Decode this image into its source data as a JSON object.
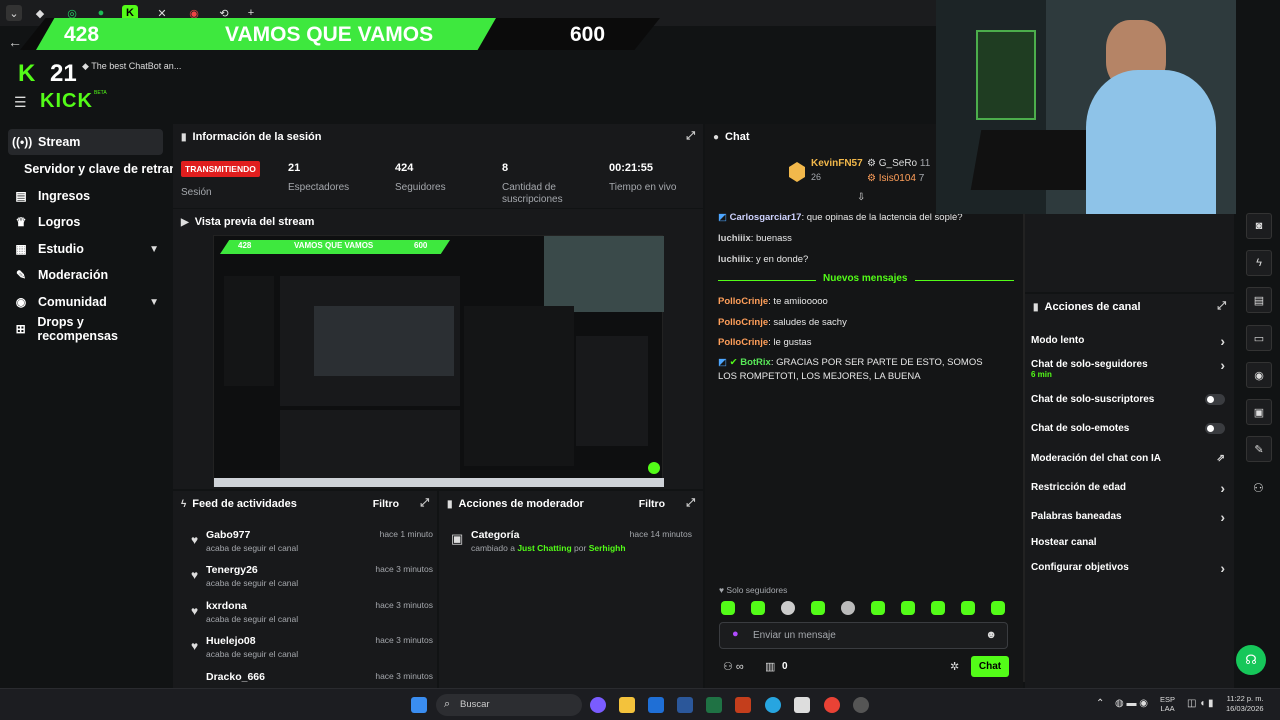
{
  "overlay": {
    "viewers": "428",
    "title": "VAMOS QUE VAMOS",
    "goal": "600",
    "kick_count": "21",
    "kick_logo": "KICK",
    "chatbot_text": "The best ChatBot an..."
  },
  "brand": {
    "logo": "KICK",
    "beta": "BETA",
    "accent": "#53fc18"
  },
  "sidebar": {
    "items": [
      {
        "label": "Stream",
        "icon": "stream-icon"
      },
      {
        "label": "Servidor y clave de retransm"
      },
      {
        "label": "Ingresos",
        "icon": "income-icon"
      },
      {
        "label": "Logros",
        "icon": "trophy-icon"
      },
      {
        "label": "Estudio",
        "icon": "studio-icon"
      },
      {
        "label": "Moderación",
        "icon": "wrench-icon"
      },
      {
        "label": "Comunidad",
        "icon": "community-icon"
      },
      {
        "label": "Drops y recompensas",
        "icon": "drops-icon"
      }
    ]
  },
  "session": {
    "title": "Información de la sesión",
    "status_badge": "TRANSMITIENDO",
    "status_label": "Sesión",
    "stats": [
      {
        "value": "21",
        "label": "Espectadores"
      },
      {
        "value": "424",
        "label": "Seguidores"
      },
      {
        "value": "8",
        "label": "Cantidad de suscripciones"
      },
      {
        "value": "00:21:55",
        "label": "Tiempo en vivo"
      }
    ]
  },
  "preview": {
    "title": "Vista previa del stream",
    "banner_viewers": "428",
    "banner_title": "VAMOS QUE VAMOS",
    "banner_goal": "600"
  },
  "activity": {
    "title": "Feed de actividades",
    "filter": "Filtro",
    "items": [
      {
        "name": "Gabo977",
        "action": "acaba de seguir el canal",
        "time": "hace 1 minuto"
      },
      {
        "name": "Tenergy26",
        "action": "acaba de seguir el canal",
        "time": "hace 3 minutos"
      },
      {
        "name": "kxrdona",
        "action": "acaba de seguir el canal",
        "time": "hace 3 minutos"
      },
      {
        "name": "Huelejo08",
        "action": "acaba de seguir el canal",
        "time": "hace 3 minutos"
      },
      {
        "name": "Dracko_666",
        "action": "",
        "time": "hace 3 minutos"
      }
    ]
  },
  "modactions": {
    "title": "Acciones de moderador",
    "filter": "Filtro",
    "item_title": "Categoría",
    "item_prefix": "cambiado a",
    "item_category": "Just Chatting",
    "item_by": "por",
    "item_user": "Serhighh",
    "item_time": "hace 14 minutos"
  },
  "chat": {
    "title": "Chat",
    "top": [
      {
        "name": "KevinFN57",
        "count": "26"
      },
      {
        "name": "G_SeRo",
        "count": "11"
      },
      {
        "name": "Isis0104",
        "count": "7"
      }
    ],
    "messages": [
      {
        "user": "Carlosgarciar17",
        "text": ": que opinas de la lactencia del soplé?"
      },
      {
        "user": "luchiiix",
        "text": ": buenass"
      },
      {
        "user": "luchiiix",
        "text": ": y en donde?"
      }
    ],
    "divider": "Nuevos mensajes",
    "new_messages": [
      {
        "user": "PolloCrinje",
        "text": ": te amiiooooo"
      },
      {
        "user": "PolloCrinje",
        "text": ": saludes de sachy"
      },
      {
        "user": "PolloCrinje",
        "text": ": le gustas"
      }
    ],
    "bot_user": "BotRix",
    "bot_text": ": GRACIAS POR SER PARTE DE ESTO, SOMOS LOS ROMPETOTI, LOS MEJORES, LA BUENA",
    "mode_label": "Solo seguidores",
    "input_placeholder": "Enviar un mensaje",
    "points": "0",
    "send_label": "Chat"
  },
  "channel_actions": {
    "title": "Acciones de canal",
    "items": [
      {
        "label": "Modo lento"
      },
      {
        "label": "Chat de solo-seguidores",
        "sub": "6 min"
      },
      {
        "label": "Chat de solo-suscriptores"
      },
      {
        "label": "Chat de solo-emotes"
      },
      {
        "label": "Moderación del chat con IA"
      },
      {
        "label": "Restricción de edad"
      },
      {
        "label": "Palabras baneadas"
      },
      {
        "label": "Hostear canal"
      },
      {
        "label": "Configurar objetivos"
      }
    ]
  },
  "taskbar": {
    "search_placeholder": "Buscar",
    "lang": "ESP",
    "region": "LAA",
    "time": "11:22 p. m.",
    "date": "16/03/2026"
  }
}
